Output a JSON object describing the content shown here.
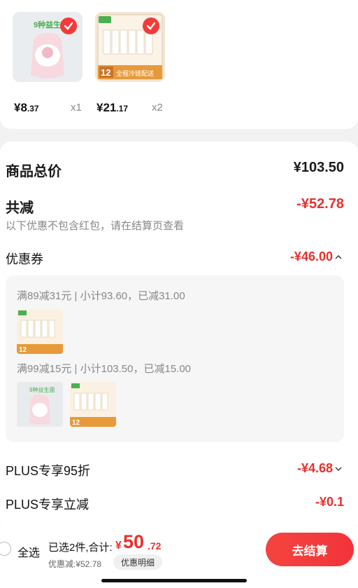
{
  "items": [
    {
      "price_int": "¥8",
      "price_dec": ".37",
      "qty": "x1",
      "thumb_text": "9种益生菌"
    },
    {
      "price_int": "¥21",
      "price_dec": ".17",
      "qty": "x2",
      "thumb_text": "全程冷链配送",
      "badge": "12"
    }
  ],
  "summary": {
    "total_label": "商品总价",
    "total_value": "¥103.50",
    "discount_label": "共减",
    "discount_value": "-¥52.78",
    "note": "以下优惠不包含红包，请在结算页查看"
  },
  "coupon": {
    "label": "优惠券",
    "value": "-¥46.00",
    "rules": [
      "满89减31元 | 小计93.60，已减31.00",
      "满99减15元 | 小计103.50，已减15.00"
    ]
  },
  "plus95": {
    "label": "PLUS专享95折",
    "value": "-¥4.68"
  },
  "plusCut": {
    "label": "PLUS专享立减",
    "value": "-¥0.1"
  },
  "bottom": {
    "select_all": "全选",
    "selected_total": "已选2件,合计:",
    "currency": "¥",
    "total_int": "50",
    "total_dec": ".72",
    "discount_note": "优惠减:¥52.78",
    "detail_button": "优惠明细",
    "checkout_button": "去结算"
  },
  "colors": {
    "accent": "#e8302d",
    "check": "#f23a3a"
  }
}
